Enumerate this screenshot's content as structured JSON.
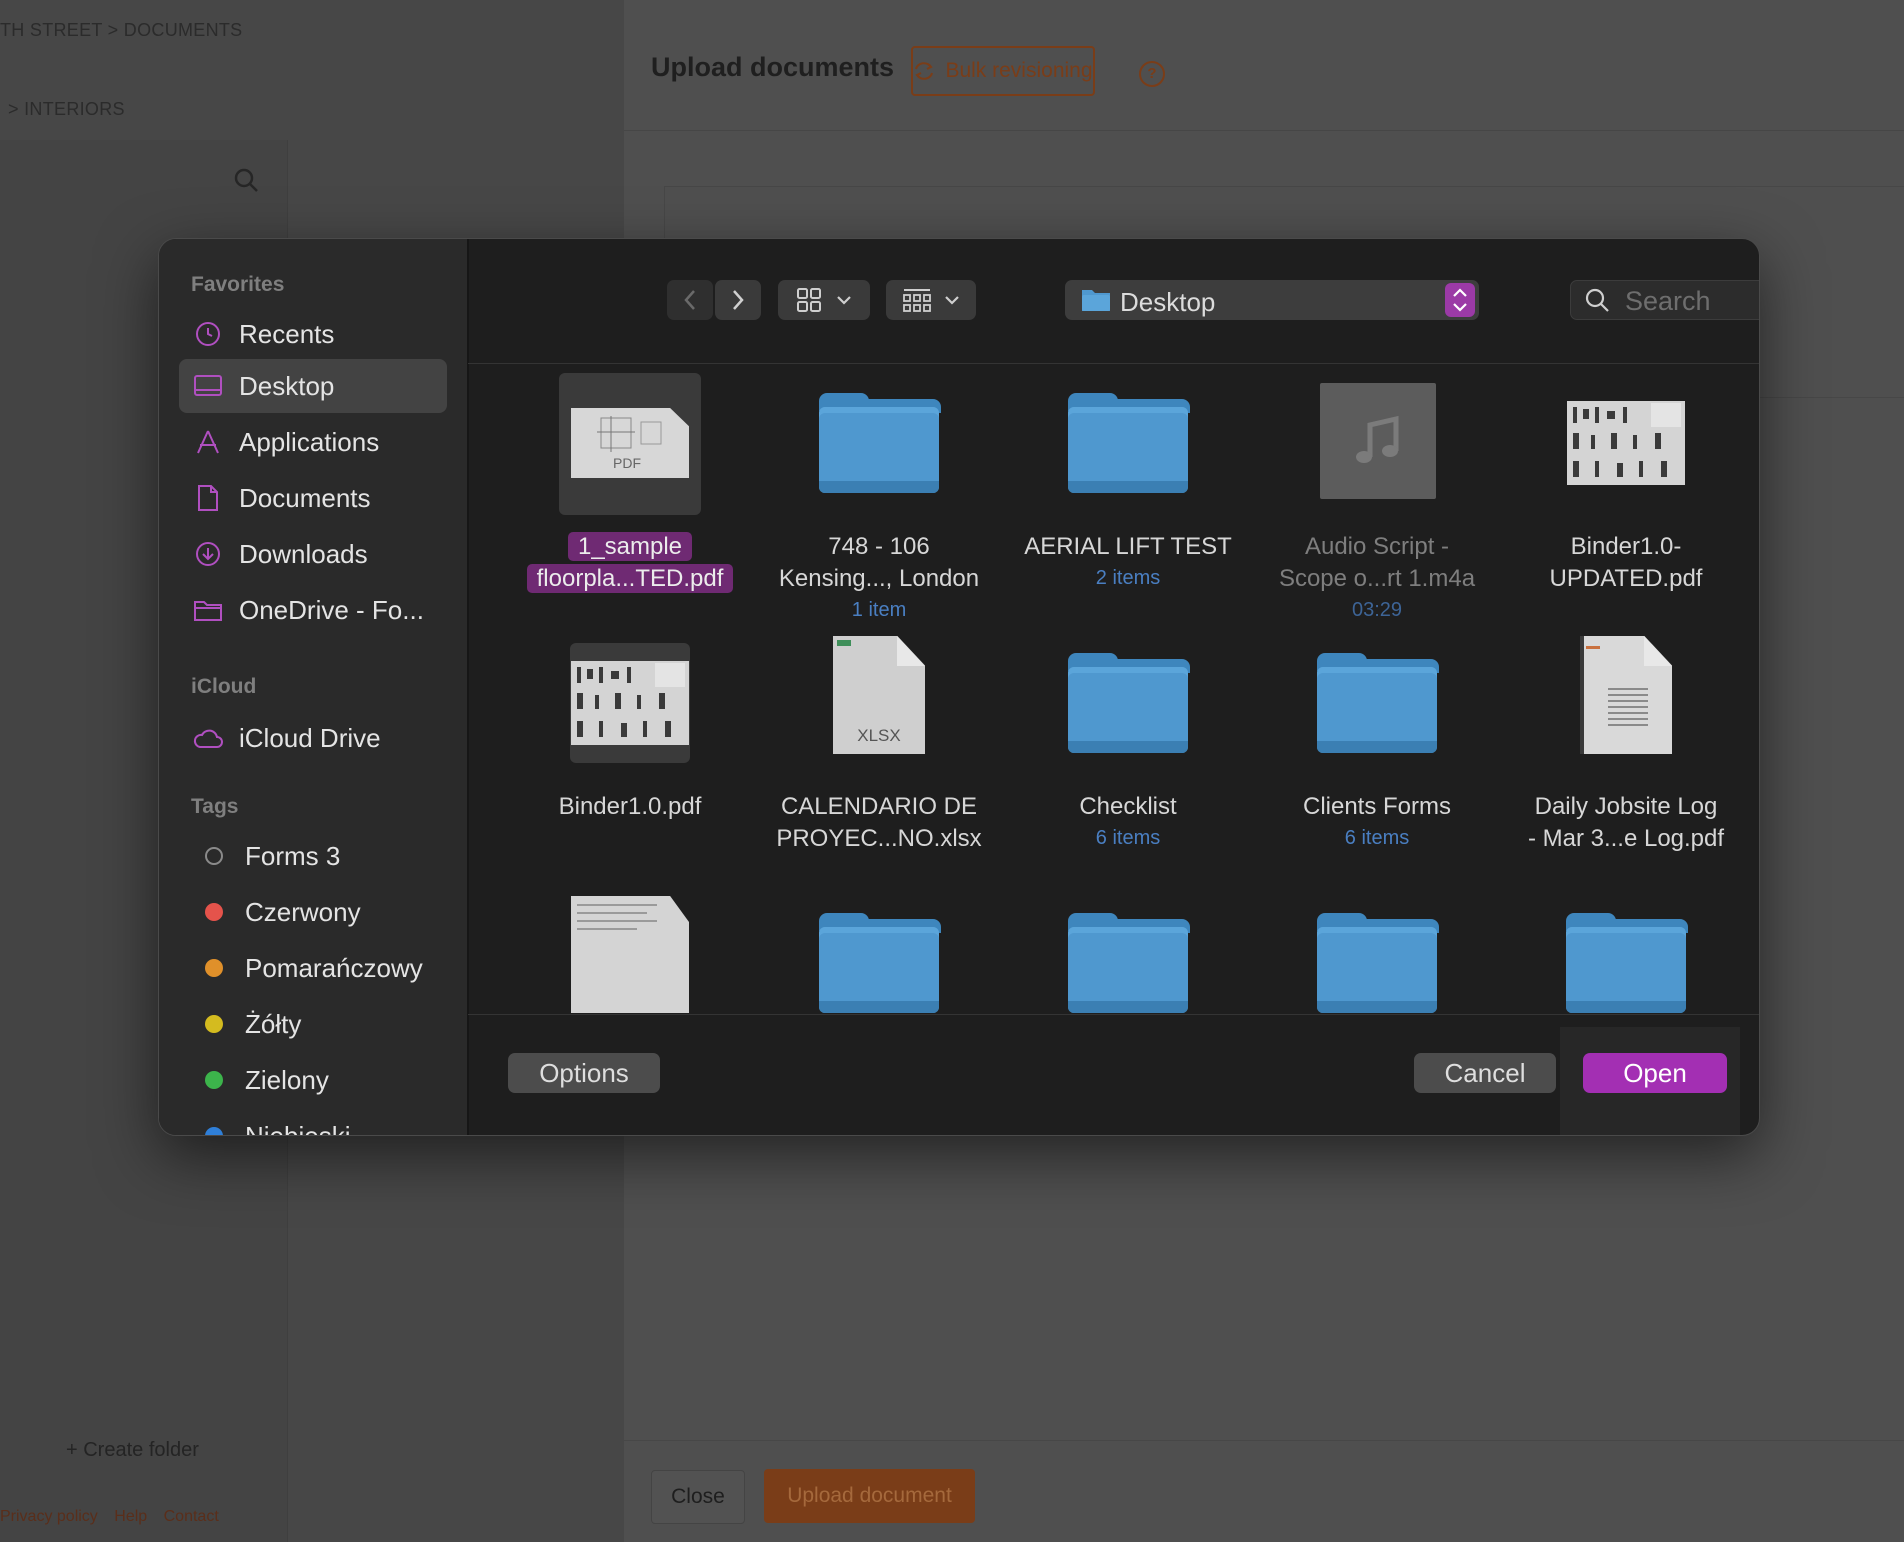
{
  "background": {
    "breadcrumb_top": "TH STREET  >  DOCUMENTS",
    "breadcrumb_sub": ">   INTERIORS",
    "create_folder": "+  Create folder",
    "footer_links": [
      "Privacy policy",
      "Help",
      "Contact"
    ],
    "upload_title": "Upload documents",
    "bulk_revisioning": "Bulk revisioning",
    "help_mark": "?",
    "close_label": "Close",
    "upload_label": "Upload document",
    "accent": "#7a3d18"
  },
  "dialog": {
    "sidebar": {
      "favorites_title": "Favorites",
      "favorites": [
        {
          "label": "Recents",
          "icon": "clock-icon"
        },
        {
          "label": "Desktop",
          "icon": "desktop-icon",
          "active": true
        },
        {
          "label": "Applications",
          "icon": "applications-icon"
        },
        {
          "label": "Documents",
          "icon": "document-icon"
        },
        {
          "label": "Downloads",
          "icon": "download-icon"
        },
        {
          "label": "OneDrive - Fo...",
          "icon": "folder-icon"
        }
      ],
      "icloud_title": "iCloud",
      "icloud": [
        {
          "label": "iCloud Drive",
          "icon": "cloud-icon"
        }
      ],
      "tags_title": "Tags",
      "tags": [
        {
          "label": "Forms 3",
          "color": "none"
        },
        {
          "label": "Czerwony",
          "color": "#e5534b"
        },
        {
          "label": "Pomarańczowy",
          "color": "#e0902a"
        },
        {
          "label": "Żółty",
          "color": "#d4bb1f"
        },
        {
          "label": "Zielony",
          "color": "#3cb44b"
        },
        {
          "label": "Niebieski",
          "color": "#2f7fd8"
        }
      ]
    },
    "toolbar": {
      "location": "Desktop",
      "search_placeholder": "Search"
    },
    "files": [
      {
        "name_line1": "1_sample",
        "name_line2": "floorpla...TED.pdf",
        "sub": "",
        "kind": "pdf",
        "selected": true
      },
      {
        "name_line1": "748 - 106",
        "name_line2": "Kensing..., London",
        "sub": "1 item",
        "kind": "folder"
      },
      {
        "name_line1": "AERIAL LIFT TEST",
        "name_line2": "",
        "sub": "2 items",
        "kind": "folder"
      },
      {
        "name_line1": "Audio Script -",
        "name_line2": "Scope o...rt 1.m4a",
        "sub": "03:29",
        "kind": "audio",
        "dimmed": true
      },
      {
        "name_line1": "Binder1.0-",
        "name_line2": "UPDATED.pdf",
        "sub": "",
        "kind": "binder"
      },
      {
        "name_line1": "Binder1.0.pdf",
        "name_line2": "",
        "sub": "",
        "kind": "binder"
      },
      {
        "name_line1": "CALENDARIO DE",
        "name_line2": "PROYEC...NO.xlsx",
        "sub": "",
        "kind": "xlsx"
      },
      {
        "name_line1": "Checklist",
        "name_line2": "",
        "sub": "6 items",
        "kind": "folder"
      },
      {
        "name_line1": "Clients Forms",
        "name_line2": "",
        "sub": "6 items",
        "kind": "folder"
      },
      {
        "name_line1": "Daily Jobsite Log",
        "name_line2": "- Mar 3...e Log.pdf",
        "sub": "",
        "kind": "log"
      }
    ],
    "buttons": {
      "options": "Options",
      "cancel": "Cancel",
      "open": "Open"
    },
    "colors": {
      "folder_blue": "#4f98cf",
      "selection_purple": "#6f2a73",
      "open_button": "#a32fb3",
      "sub_text_blue": "#4a7fc2"
    }
  }
}
